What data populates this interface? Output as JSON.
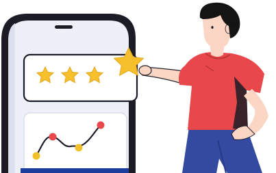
{
  "illustration": {
    "icons": [
      "phone-icon",
      "star-icon",
      "line-chart-icon",
      "person-icon"
    ],
    "rating": {
      "value": 4,
      "max": 4,
      "filled_stars": 3,
      "held_stars": 1
    },
    "chart": {
      "point_colors": [
        "#f0c12a",
        "#e8484b",
        "#f0c12a",
        "#e8484b"
      ]
    },
    "colors": {
      "phone_body": "#eef0f8",
      "phone_outline": "#1b1c26",
      "card": "#ffffff",
      "star": "#f6bf2c",
      "chart_line": "#1b1c26",
      "accent_bar": "#1d3d9b",
      "shirt": "#e8484b",
      "pants": "#334aa0",
      "skin": "#fbd6c4",
      "hair": "#141414"
    }
  }
}
